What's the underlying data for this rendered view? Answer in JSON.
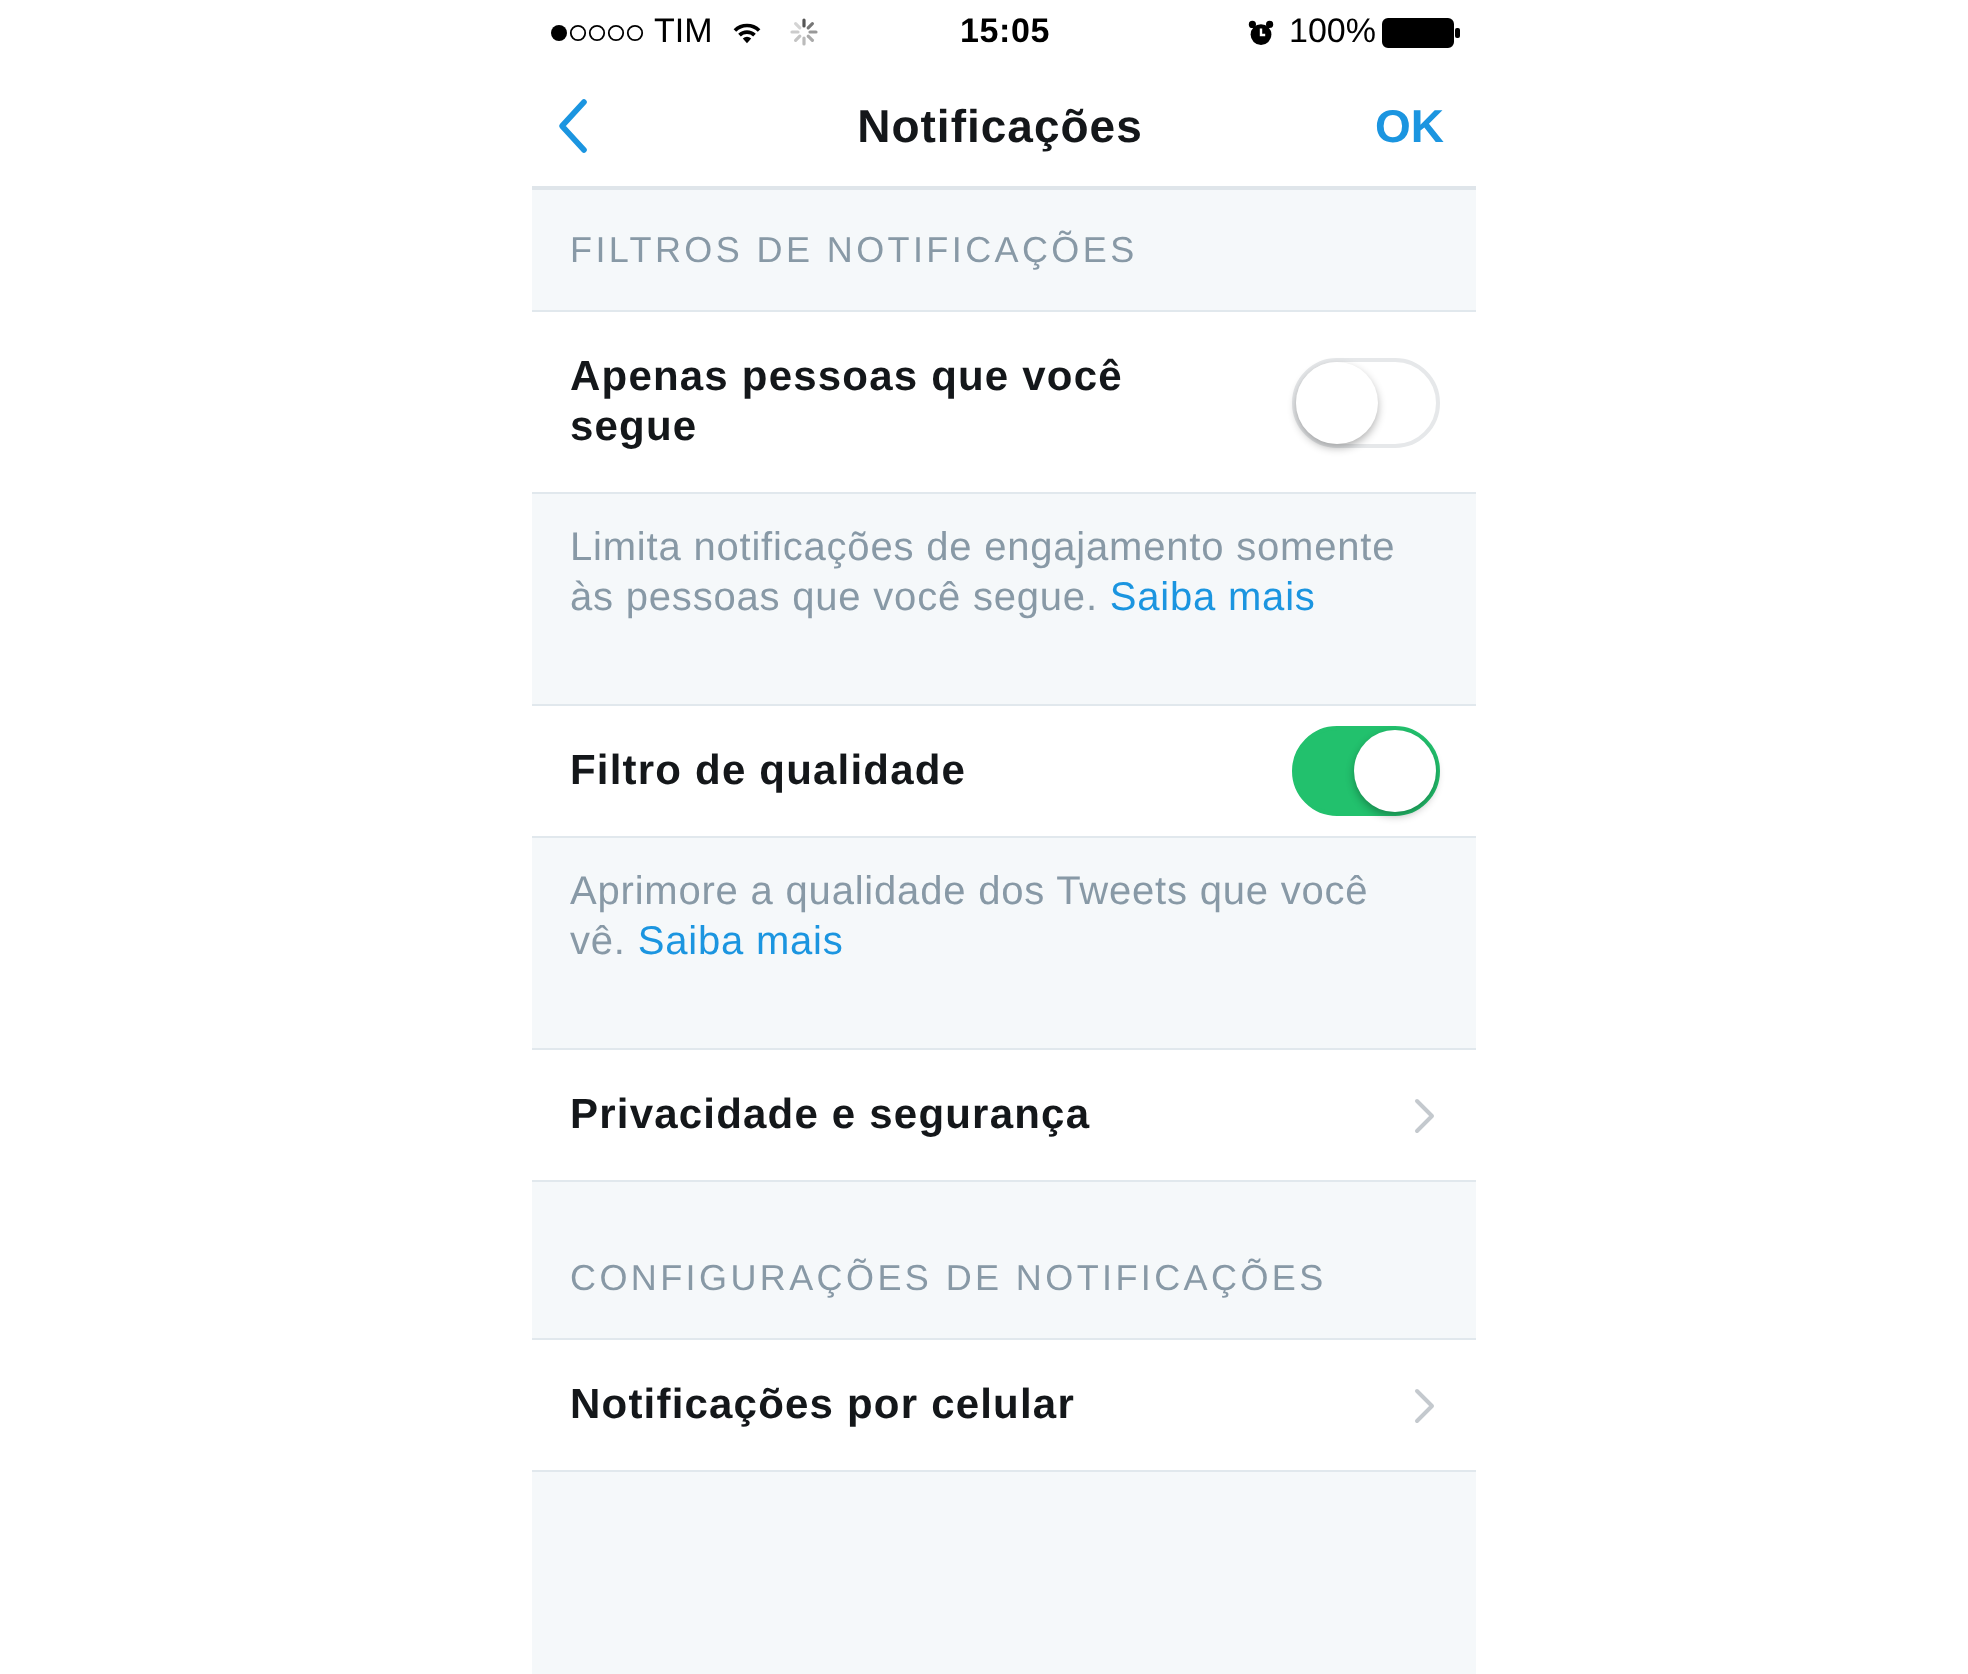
{
  "status_bar": {
    "carrier": "TIM",
    "time": "15:05",
    "battery": "100%"
  },
  "nav_bar": {
    "title": "Notificações",
    "action": "OK"
  },
  "items": [
    {
      "kind": "header",
      "label": "FILTROS DE NOTIFICAÇÕES"
    },
    {
      "kind": "toggle",
      "label": "Apenas pessoas que você segue",
      "on": false
    },
    {
      "kind": "note",
      "text": "Limita notificações de engajamento somente às pessoas que você segue.",
      "link": "Saiba mais"
    },
    {
      "kind": "toggle",
      "label": "Filtro de qualidade",
      "on": true
    },
    {
      "kind": "note",
      "text": "Aprimore a qualidade dos Tweets que você vê.",
      "link": "Saiba mais"
    },
    {
      "kind": "link",
      "label": "Privacidade e segurança"
    },
    {
      "kind": "header",
      "label": "CONFIGURAÇÕES DE NOTIFICAÇÕES"
    },
    {
      "kind": "link",
      "label": "Notificações por celular"
    }
  ]
}
